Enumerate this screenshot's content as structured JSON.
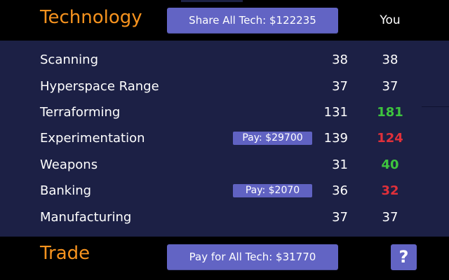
{
  "header": {
    "title": "Technology",
    "share_button_label": "Share All Tech: $122235",
    "you_label": "You"
  },
  "technologies": [
    {
      "name": "Scanning",
      "their_level": "38",
      "your_level": "38",
      "your_level_status": "equal",
      "pay_label": ""
    },
    {
      "name": "Hyperspace Range",
      "their_level": "37",
      "your_level": "37",
      "your_level_status": "equal",
      "pay_label": ""
    },
    {
      "name": "Terraforming",
      "their_level": "131",
      "your_level": "181",
      "your_level_status": "ahead",
      "pay_label": ""
    },
    {
      "name": "Experimentation",
      "their_level": "139",
      "your_level": "124",
      "your_level_status": "behind",
      "pay_label": "Pay: $29700"
    },
    {
      "name": "Weapons",
      "their_level": "31",
      "your_level": "40",
      "your_level_status": "ahead",
      "pay_label": ""
    },
    {
      "name": "Banking",
      "their_level": "36",
      "your_level": "32",
      "your_level_status": "behind",
      "pay_label": "Pay: $2070"
    },
    {
      "name": "Manufacturing",
      "their_level": "37",
      "your_level": "37",
      "your_level_status": "equal",
      "pay_label": ""
    }
  ],
  "footer": {
    "title": "Trade",
    "pay_all_button_label": "Pay for All Tech: $31770",
    "help_button_label": "?"
  },
  "colors": {
    "accent_orange": "#f7931e",
    "button_purple": "#6264c4",
    "panel_navy": "#1c2045",
    "level_ahead": "#3ec53e",
    "level_behind": "#e0303a",
    "level_equal": "#ffffff"
  }
}
